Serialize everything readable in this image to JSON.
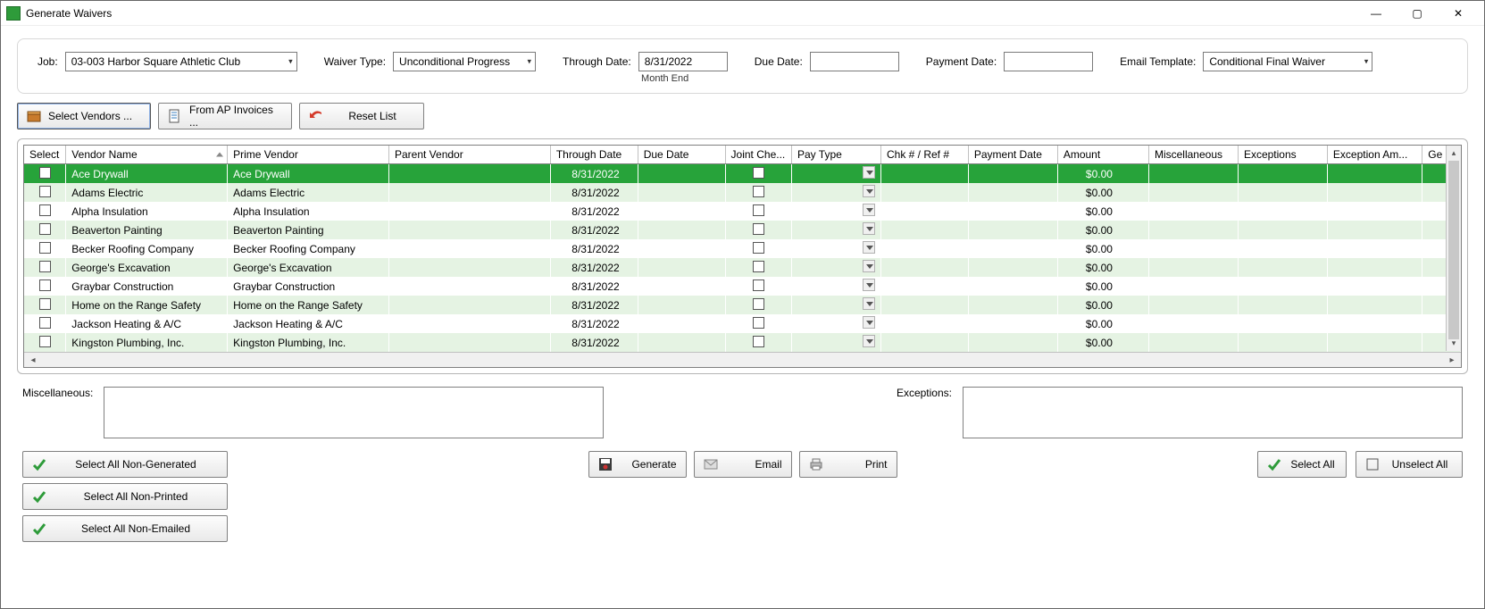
{
  "window": {
    "title": "Generate Waivers"
  },
  "filters": {
    "job_label": "Job:",
    "job_value": "03-003  Harbor Square Athletic Club",
    "waiver_type_label": "Waiver Type:",
    "waiver_type_value": "Unconditional Progress",
    "through_date_label": "Through Date:",
    "through_date_value": "8/31/2022",
    "through_date_sub": "Month End",
    "due_date_label": "Due Date:",
    "due_date_value": "",
    "payment_date_label": "Payment Date:",
    "payment_date_value": "",
    "email_template_label": "Email Template:",
    "email_template_value": "Conditional Final Waiver"
  },
  "toolbar": {
    "select_vendors": "Select Vendors ...",
    "from_ap": "From AP Invoices ...",
    "reset": "Reset List"
  },
  "columns": {
    "select": "Select",
    "vendor": "Vendor Name",
    "prime": "Prime Vendor",
    "parent": "Parent Vendor",
    "through": "Through Date",
    "due": "Due Date",
    "joint": "Joint Che...",
    "pay": "Pay Type",
    "chk": "Chk # / Ref #",
    "pdate": "Payment Date",
    "amount": "Amount",
    "misc": "Miscellaneous",
    "exc": "Exceptions",
    "excamt": "Exception Am...",
    "gen": "Ge"
  },
  "rows": [
    {
      "vendor": "Ace Drywall",
      "prime": "Ace Drywall",
      "through": "8/31/2022",
      "amount": "$0.00",
      "selected": true
    },
    {
      "vendor": "Adams Electric",
      "prime": "Adams Electric",
      "through": "8/31/2022",
      "amount": "$0.00"
    },
    {
      "vendor": "Alpha Insulation",
      "prime": "Alpha Insulation",
      "through": "8/31/2022",
      "amount": "$0.00"
    },
    {
      "vendor": "Beaverton Painting",
      "prime": "Beaverton Painting",
      "through": "8/31/2022",
      "amount": "$0.00"
    },
    {
      "vendor": "Becker Roofing Company",
      "prime": "Becker Roofing Company",
      "through": "8/31/2022",
      "amount": "$0.00"
    },
    {
      "vendor": "George's Excavation",
      "prime": "George's Excavation",
      "through": "8/31/2022",
      "amount": "$0.00"
    },
    {
      "vendor": "Graybar Construction",
      "prime": "Graybar Construction",
      "through": "8/31/2022",
      "amount": "$0.00"
    },
    {
      "vendor": "Home on the Range Safety",
      "prime": "Home on the Range Safety",
      "through": "8/31/2022",
      "amount": "$0.00"
    },
    {
      "vendor": "Jackson Heating & A/C",
      "prime": "Jackson Heating & A/C",
      "through": "8/31/2022",
      "amount": "$0.00"
    },
    {
      "vendor": "Kingston Plumbing, Inc.",
      "prime": "Kingston Plumbing, Inc.",
      "through": "8/31/2022",
      "amount": "$0.00"
    }
  ],
  "bottom": {
    "misc_label": "Miscellaneous:",
    "exc_label": "Exceptions:"
  },
  "buttons": {
    "sel_non_gen": "Select All Non-Generated",
    "sel_non_print": "Select All Non-Printed",
    "sel_non_email": "Select All Non-Emailed",
    "generate": "Generate",
    "email": "Email",
    "print": "Print",
    "select_all": "Select All",
    "unselect_all": "Unselect All"
  }
}
